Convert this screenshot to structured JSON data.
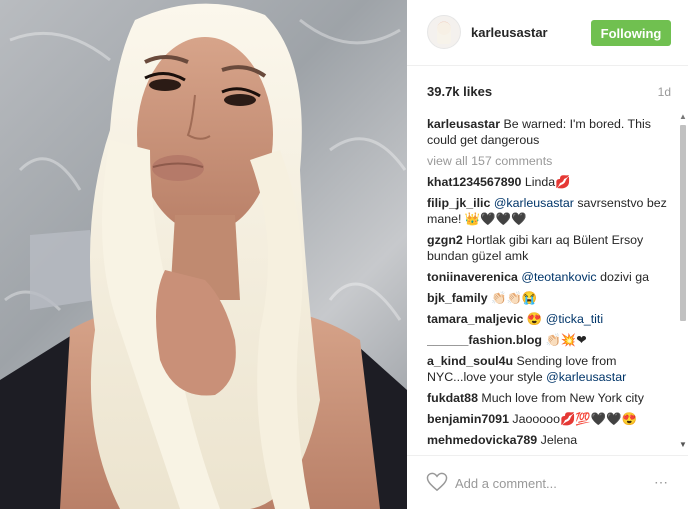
{
  "header": {
    "username": "karleusastar",
    "follow_label": "Following"
  },
  "stats": {
    "likes": "39.7k likes",
    "time_ago": "1d"
  },
  "caption": {
    "username": "karleusastar",
    "text": "Be warned: I'm bored. This could get dangerous"
  },
  "view_all": "view all 157 comments",
  "comments": [
    {
      "user": "khat1234567890",
      "parts": [
        {
          "t": "Linda💋",
          "m": false
        }
      ]
    },
    {
      "user": "filip_jk_ilic",
      "parts": [
        {
          "t": "@karleusastar",
          "m": true
        },
        {
          "t": " savrsenstvo bez mane! 👑🖤🖤🖤",
          "m": false
        }
      ]
    },
    {
      "user": "gzgn2",
      "parts": [
        {
          "t": "Hortlak gibi karı aq Bülent Ersoy bundan güzel amk",
          "m": false
        }
      ]
    },
    {
      "user": "toniinaverenica",
      "parts": [
        {
          "t": "@teotankovic",
          "m": true
        },
        {
          "t": " dozivi ga",
          "m": false
        }
      ]
    },
    {
      "user": "bjk_family",
      "parts": [
        {
          "t": "👏🏻👏🏻😭",
          "m": false
        }
      ]
    },
    {
      "user": "tamara_maljevic",
      "parts": [
        {
          "t": "😍 ",
          "m": false
        },
        {
          "t": "@ticka_titi",
          "m": true
        }
      ]
    },
    {
      "user": "______fashion.blog",
      "parts": [
        {
          "t": "👏🏻💥❤",
          "m": false
        }
      ]
    },
    {
      "user": "a_kind_soul4u",
      "parts": [
        {
          "t": "Sending love from NYC...love your style ",
          "m": false
        },
        {
          "t": "@karleusastar",
          "m": true
        }
      ]
    },
    {
      "user": "fukdat88",
      "parts": [
        {
          "t": "Much love from New York city",
          "m": false
        }
      ]
    },
    {
      "user": "benjamin7091",
      "parts": [
        {
          "t": "Jaooooo💋💯🖤🖤😍",
          "m": false
        }
      ]
    },
    {
      "user": "mehmedovicka789",
      "parts": [
        {
          "t": "Jelena",
          "m": false
        }
      ]
    }
  ],
  "footer": {
    "comment_placeholder": "Add a comment...",
    "more_label": "⋯",
    "heart_icon": "heart-outline-icon"
  },
  "colors": {
    "follow_green": "#70c050",
    "mention_blue": "#003569",
    "muted_gray": "#999999"
  }
}
